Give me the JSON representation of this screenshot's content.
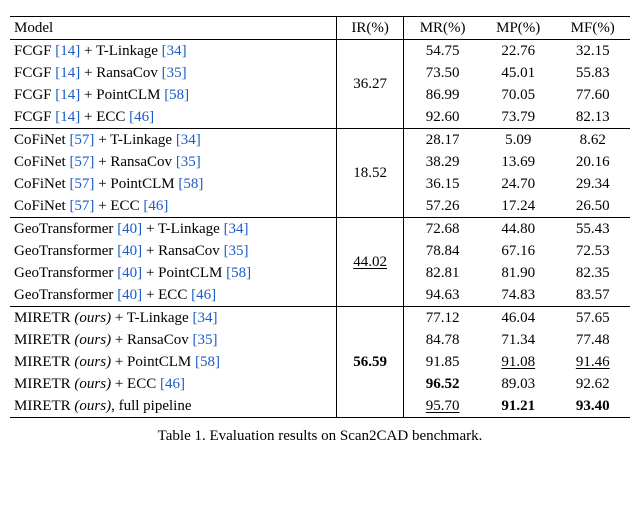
{
  "columns": {
    "model": "Model",
    "ir": "IR(%)",
    "mr": "MR(%)",
    "mp": "MP(%)",
    "mf": "MF(%)"
  },
  "methods": {
    "fcgf": {
      "name": "FCGF",
      "cite": "[14]"
    },
    "cofi": {
      "name": "CoFiNet",
      "cite": "[57]"
    },
    "geo": {
      "name": "GeoTransformer",
      "cite": "[40]"
    },
    "mir": {
      "name": "MIRETR",
      "note": "(ours)"
    }
  },
  "algos": {
    "tl": {
      "name": "T-Linkage",
      "cite": "[34]"
    },
    "rc": {
      "name": "RansaCov",
      "cite": "[35]"
    },
    "pc": {
      "name": "PointCLM",
      "cite": "[58]"
    },
    "ecc": {
      "name": "ECC",
      "cite": "[46]"
    },
    "fp": {
      "name": "full pipeline"
    }
  },
  "groups": [
    {
      "ir": "36.27",
      "ir_style": "",
      "rows": [
        {
          "m": "fcgf",
          "a": "tl",
          "mr": "54.75",
          "mp": "22.76",
          "mf": "32.15"
        },
        {
          "m": "fcgf",
          "a": "rc",
          "mr": "73.50",
          "mp": "45.01",
          "mf": "55.83"
        },
        {
          "m": "fcgf",
          "a": "pc",
          "mr": "86.99",
          "mp": "70.05",
          "mf": "77.60"
        },
        {
          "m": "fcgf",
          "a": "ecc",
          "mr": "92.60",
          "mp": "73.79",
          "mf": "82.13"
        }
      ]
    },
    {
      "ir": "18.52",
      "ir_style": "",
      "rows": [
        {
          "m": "cofi",
          "a": "tl",
          "mr": "28.17",
          "mp": "5.09",
          "mf": "8.62"
        },
        {
          "m": "cofi",
          "a": "rc",
          "mr": "38.29",
          "mp": "13.69",
          "mf": "20.16"
        },
        {
          "m": "cofi",
          "a": "pc",
          "mr": "36.15",
          "mp": "24.70",
          "mf": "29.34"
        },
        {
          "m": "cofi",
          "a": "ecc",
          "mr": "57.26",
          "mp": "17.24",
          "mf": "26.50"
        }
      ]
    },
    {
      "ir": "44.02",
      "ir_style": "underline",
      "rows": [
        {
          "m": "geo",
          "a": "tl",
          "mr": "72.68",
          "mp": "44.80",
          "mf": "55.43"
        },
        {
          "m": "geo",
          "a": "rc",
          "mr": "78.84",
          "mp": "67.16",
          "mf": "72.53"
        },
        {
          "m": "geo",
          "a": "pc",
          "mr": "82.81",
          "mp": "81.90",
          "mf": "82.35"
        },
        {
          "m": "geo",
          "a": "ecc",
          "mr": "94.63",
          "mp": "74.83",
          "mf": "83.57"
        }
      ]
    },
    {
      "ir": "56.59",
      "ir_style": "bold",
      "rows": [
        {
          "m": "mir",
          "a": "tl",
          "mr": "77.12",
          "mp": "46.04",
          "mf": "57.65"
        },
        {
          "m": "mir",
          "a": "rc",
          "mr": "84.78",
          "mp": "71.34",
          "mf": "77.48"
        },
        {
          "m": "mir",
          "a": "pc",
          "mr": "91.85",
          "mp": "91.08",
          "mp_style": "underline",
          "mf": "91.46",
          "mf_style": "underline"
        },
        {
          "m": "mir",
          "a": "ecc",
          "mr": "96.52",
          "mr_style": "bold",
          "mp": "89.03",
          "mf": "92.62"
        },
        {
          "m": "mir",
          "a": "fp",
          "mr": "95.70",
          "mr_style": "underline",
          "mp": "91.21",
          "mp_style": "bold",
          "mf": "93.40",
          "mf_style": "bold"
        }
      ]
    }
  ],
  "caption": "Table 1. Evaluation results on Scan2CAD benchmark.",
  "chart_data": {
    "type": "table",
    "title": "Evaluation results on Scan2CAD benchmark",
    "columns": [
      "Model",
      "IR(%)",
      "MR(%)",
      "MP(%)",
      "MF(%)"
    ],
    "rows": [
      [
        "FCGF [14] + T-Linkage [34]",
        36.27,
        54.75,
        22.76,
        32.15
      ],
      [
        "FCGF [14] + RansaCov [35]",
        36.27,
        73.5,
        45.01,
        55.83
      ],
      [
        "FCGF [14] + PointCLM [58]",
        36.27,
        86.99,
        70.05,
        77.6
      ],
      [
        "FCGF [14] + ECC [46]",
        36.27,
        92.6,
        73.79,
        82.13
      ],
      [
        "CoFiNet [57] + T-Linkage [34]",
        18.52,
        28.17,
        5.09,
        8.62
      ],
      [
        "CoFiNet [57] + RansaCov [35]",
        18.52,
        38.29,
        13.69,
        20.16
      ],
      [
        "CoFiNet [57] + PointCLM [58]",
        18.52,
        36.15,
        24.7,
        29.34
      ],
      [
        "CoFiNet [57] + ECC [46]",
        18.52,
        57.26,
        17.24,
        26.5
      ],
      [
        "GeoTransformer [40] + T-Linkage [34]",
        44.02,
        72.68,
        44.8,
        55.43
      ],
      [
        "GeoTransformer [40] + RansaCov [35]",
        44.02,
        78.84,
        67.16,
        72.53
      ],
      [
        "GeoTransformer [40] + PointCLM [58]",
        44.02,
        82.81,
        81.9,
        82.35
      ],
      [
        "GeoTransformer [40] + ECC [46]",
        44.02,
        94.63,
        74.83,
        83.57
      ],
      [
        "MIRETR (ours) + T-Linkage [34]",
        56.59,
        77.12,
        46.04,
        57.65
      ],
      [
        "MIRETR (ours) + RansaCov [35]",
        56.59,
        84.78,
        71.34,
        77.48
      ],
      [
        "MIRETR (ours) + PointCLM [58]",
        56.59,
        91.85,
        91.08,
        91.46
      ],
      [
        "MIRETR (ours) + ECC [46]",
        56.59,
        96.52,
        89.03,
        92.62
      ],
      [
        "MIRETR (ours), full pipeline",
        56.59,
        95.7,
        91.21,
        93.4
      ]
    ]
  }
}
